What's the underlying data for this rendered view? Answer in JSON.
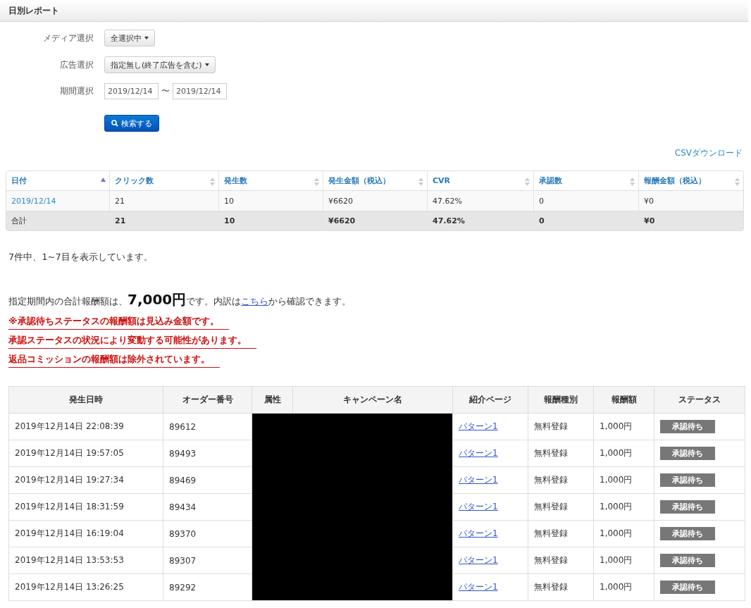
{
  "page_title": "日別レポート",
  "filters": [
    {
      "kind": "dropdown",
      "label": "メディア選択",
      "value": "全選択中"
    },
    {
      "kind": "dropdown",
      "label": "広告選択",
      "value": "指定無し(終了広告を含む)"
    },
    {
      "kind": "range",
      "label": "期間選択",
      "from": "2019/12/14",
      "separator": "〜",
      "to": "2019/12/14"
    }
  ],
  "search_button": "検索する",
  "csv_link": "CSVダウンロード",
  "summary_table": {
    "columns": [
      {
        "label": "日付",
        "sorted": true
      },
      {
        "label": "クリック数",
        "sorted": false
      },
      {
        "label": "発生数",
        "sorted": false
      },
      {
        "label": "発生金額（税込）",
        "sorted": false
      },
      {
        "label": "CVR",
        "sorted": false
      },
      {
        "label": "承認数",
        "sorted": false
      },
      {
        "label": "報酬金額（税込）",
        "sorted": false
      }
    ],
    "rows": [
      [
        "2019/12/14",
        "21",
        "10",
        "¥6620",
        "47.62%",
        "0",
        "¥0"
      ]
    ],
    "total": [
      "合計",
      "21",
      "10",
      "¥6620",
      "47.62%",
      "0",
      "¥0"
    ]
  },
  "count_text": "7件中、1~7目を表示しています。",
  "summary": {
    "prefix": "指定期間内の合計報酬額は、",
    "amount": "7,000円",
    "middle": "です。内訳は",
    "link": "こちら",
    "suffix": "から確認できます。"
  },
  "notes": [
    "※承認待ちステータスの報酬額は見込み金額です。",
    "承認ステータスの状況により変動する可能性があります。",
    "返品コミッションの報酬額は除外されています。"
  ],
  "orders": {
    "columns": [
      "発生日時",
      "オーダー番号",
      "属性",
      "キャンペーン名",
      "紹介ページ",
      "報酬種別",
      "報酬額",
      "ステータス"
    ],
    "rows": [
      {
        "datetime": "2019年12月14日 22:08:39",
        "order": "89612",
        "page": "パターン1",
        "type": "無料登録",
        "amount": "1,000円",
        "status": "承認待ち"
      },
      {
        "datetime": "2019年12月14日 19:57:05",
        "order": "89493",
        "page": "パターン1",
        "type": "無料登録",
        "amount": "1,000円",
        "status": "承認待ち"
      },
      {
        "datetime": "2019年12月14日 19:27:34",
        "order": "89469",
        "page": "パターン1",
        "type": "無料登録",
        "amount": "1,000円",
        "status": "承認待ち"
      },
      {
        "datetime": "2019年12月14日 18:31:59",
        "order": "89434",
        "page": "パターン1",
        "type": "無料登録",
        "amount": "1,000円",
        "status": "承認待ち"
      },
      {
        "datetime": "2019年12月14日 16:19:04",
        "order": "89370",
        "page": "パターン1",
        "type": "無料登録",
        "amount": "1,000円",
        "status": "承認待ち"
      },
      {
        "datetime": "2019年12月14日 13:53:53",
        "order": "89307",
        "page": "パターン1",
        "type": "無料登録",
        "amount": "1,000円",
        "status": "承認待ち"
      },
      {
        "datetime": "2019年12月14日 13:26:25",
        "order": "89292",
        "page": "パターン1",
        "type": "無料登録",
        "amount": "1,000円",
        "status": "承認待ち"
      }
    ]
  }
}
